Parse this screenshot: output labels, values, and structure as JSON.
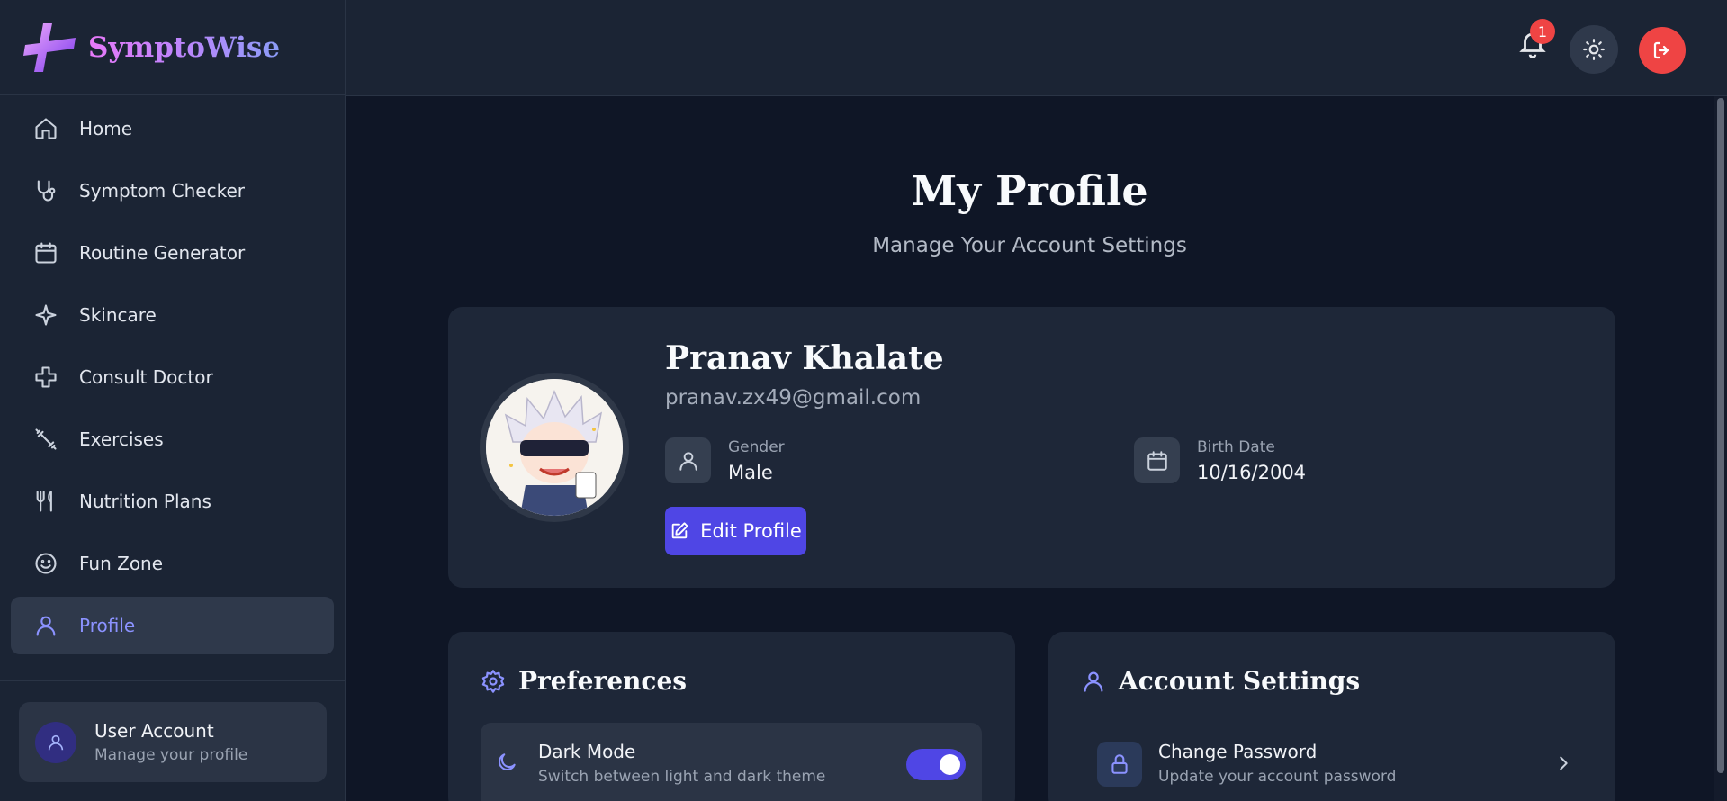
{
  "brand": {
    "name": "SymptoWise"
  },
  "sidebar": {
    "items": [
      {
        "label": "Home",
        "icon": "home-icon"
      },
      {
        "label": "Symptom Checker",
        "icon": "stethoscope-icon"
      },
      {
        "label": "Routine Generator",
        "icon": "calendar-icon"
      },
      {
        "label": "Skincare",
        "icon": "sparkle-icon"
      },
      {
        "label": "Consult Doctor",
        "icon": "medical-cross-icon"
      },
      {
        "label": "Exercises",
        "icon": "dumbbell-icon"
      },
      {
        "label": "Nutrition Plans",
        "icon": "utensils-icon"
      },
      {
        "label": "Fun Zone",
        "icon": "smile-icon"
      },
      {
        "label": "Profile",
        "icon": "user-icon",
        "active": true
      }
    ],
    "user_card": {
      "title": "User Account",
      "subtitle": "Manage your profile"
    }
  },
  "topbar": {
    "notifications_count": "1",
    "theme_icon": "sun-icon",
    "logout_icon": "logout-icon"
  },
  "page": {
    "title": "My Profile",
    "subtitle": "Manage Your Account Settings"
  },
  "profile": {
    "name": "Pranav Khalate",
    "email": "pranav.zx49@gmail.com",
    "gender_label": "Gender",
    "gender_value": "Male",
    "birth_label": "Birth Date",
    "birth_value": "10/16/2004",
    "edit_label": "Edit Profile"
  },
  "preferences": {
    "title": "Preferences",
    "dark_mode_title": "Dark Mode",
    "dark_mode_sub": "Switch between light and dark theme",
    "dark_mode_on": true
  },
  "account": {
    "title": "Account Settings",
    "change_password_title": "Change Password",
    "change_password_sub": "Update your account password"
  },
  "colors": {
    "accent": "#4f46e5",
    "accent_light": "#8b92ff",
    "danger": "#ef4444",
    "sidebar_bg": "#1b2434",
    "main_bg": "#0f1626"
  }
}
